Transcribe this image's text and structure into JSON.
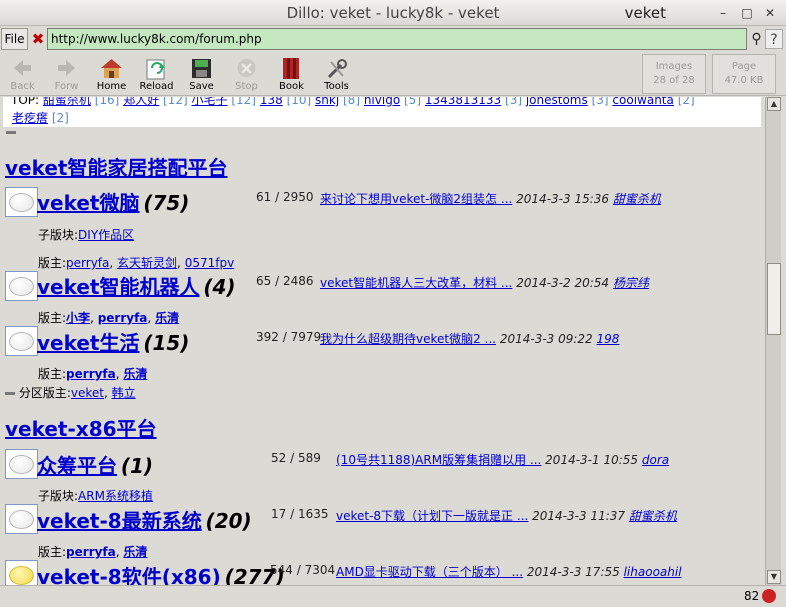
{
  "window": {
    "title": "Dillo: veket - lucky8k - veket",
    "app_name": "veket",
    "min": "–",
    "max": "□",
    "close": "✕"
  },
  "urlbar": {
    "file_label": "File",
    "url": "http://www.lucky8k.com/forum.php"
  },
  "toolbar": {
    "back": "Back",
    "forward": "Forw",
    "home": "Home",
    "reload": "Reload",
    "save": "Save",
    "stop": "Stop",
    "book": "Book",
    "tools": "Tools",
    "images_label": "Images",
    "images_value": "28 of 28",
    "page_label": "Page",
    "page_value": "47.0 KB"
  },
  "top_list": {
    "prefix": "TOP:",
    "items": [
      {
        "name": "甜蜜杀机",
        "count": "[16]"
      },
      {
        "name": "郑人好",
        "count": "[12]"
      },
      {
        "name": "小宅子",
        "count": "[12]"
      },
      {
        "name": "138",
        "count": "[10]"
      },
      {
        "name": "shkj",
        "count": "[8]"
      },
      {
        "name": "nivigo",
        "count": "[5]"
      },
      {
        "name": "1343813133",
        "count": "[3]"
      },
      {
        "name": "jonestoms",
        "count": "[3]"
      },
      {
        "name": "coolwanta",
        "count": "[2]"
      }
    ],
    "last_item": {
      "name": "老疙瘩",
      "count": "[2]"
    }
  },
  "sections": [
    {
      "title": "veket智能家居搭配平台",
      "forums": [
        {
          "name": "veket微脑",
          "count": "(75)",
          "stats": "61 / 2950",
          "last_title": "来讨论下想用veket-微脑2组装怎 ...",
          "last_date": "2014-3-3 15:36",
          "last_user": "甜蜜杀机",
          "sub_label": "子版块:",
          "subs": [
            "DIY作品区"
          ],
          "mod_label": "版主:",
          "mods": [
            "perryfa",
            "玄天斩灵剑",
            "0571fpv"
          ]
        },
        {
          "name": "veket智能机器人",
          "count": "(4)",
          "stats": "65 / 2486",
          "last_title": "veket智能机器人三大改革，材料 ...",
          "last_date": "2014-3-2 20:54",
          "last_user": "杨宗纬",
          "mod_label": "版主:",
          "mods": [
            "小李",
            "perryfa",
            "乐清"
          ]
        },
        {
          "name": "veket生活",
          "count": "(15)",
          "stats": "392 / 7979",
          "last_title": "我为什么超级期待veket微脑2 ...",
          "last_date": "2014-3-3 09:22",
          "last_user": "198",
          "mod_label": "版主:",
          "mods": [
            "perryfa",
            "乐清"
          ]
        }
      ],
      "zone_mod_label": "分区版主:",
      "zone_mods": [
        "veket",
        "韩立"
      ]
    },
    {
      "title": "veket-x86平台",
      "forums": [
        {
          "name": "众筹平台",
          "count": "(1)",
          "stats": "52 / 589",
          "last_title": "(10号共1188)ARM版筹集捐赠以用 ...",
          "last_date": "2014-3-1 10:55",
          "last_user": "dora",
          "sub_label": "子版块:",
          "subs": [
            "ARM系统移植"
          ]
        },
        {
          "name": "veket-8最新系统",
          "count": "(20)",
          "stats": "17 / 1635",
          "last_title": "veket-8下载（计划下一版就是正 ...",
          "last_date": "2014-3-3 11:37",
          "last_user": "甜蜜杀机",
          "mod_label": "版主:",
          "mods": [
            "perryfa",
            "乐清"
          ]
        },
        {
          "name": "veket-8软件(x86)",
          "count": "(277)",
          "stats": "544 / 7304",
          "last_title": "AMD显卡驱动下载（三个版本） ...",
          "last_date": "2014-3-3 17:55",
          "last_user": "lihaooahil"
        }
      ]
    }
  ],
  "statusbar": {
    "counter": "82"
  }
}
